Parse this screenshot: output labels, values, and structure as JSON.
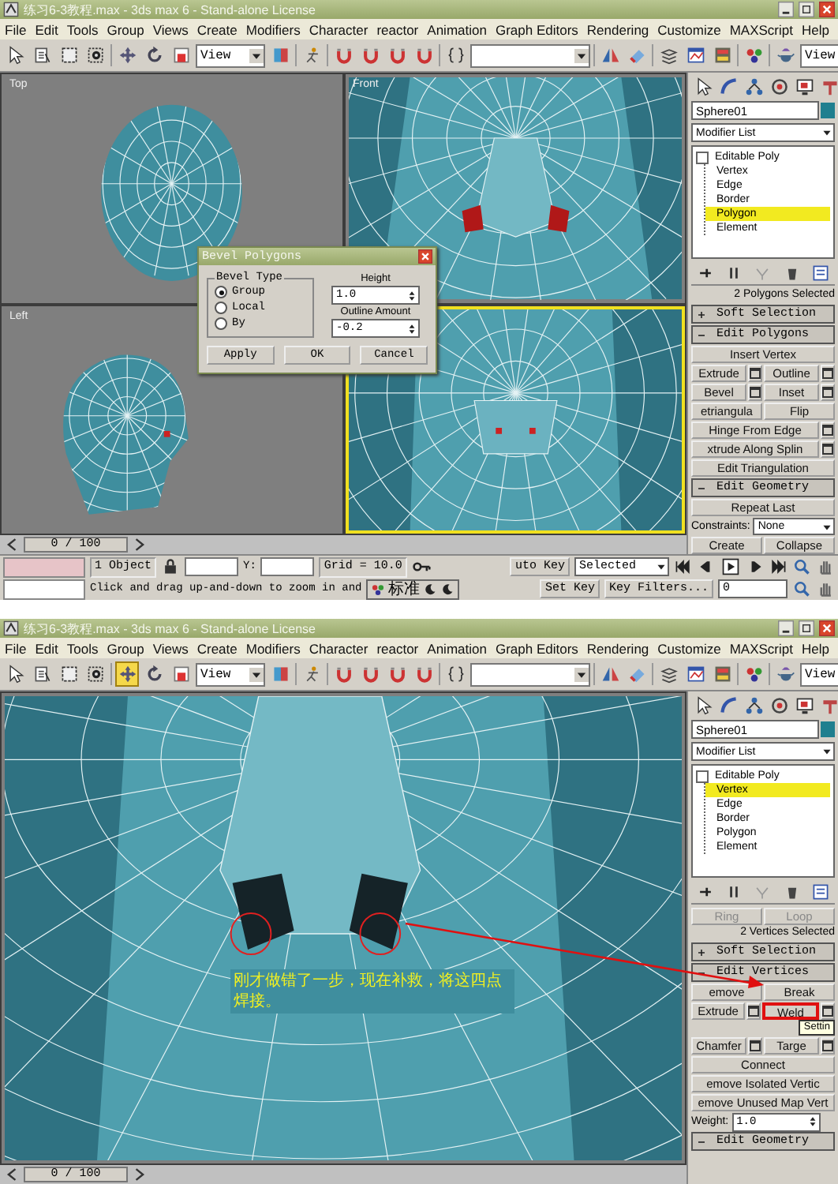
{
  "screens": [
    {
      "title": "练习6-3教程.max - 3ds max 6 - Stand-alone License",
      "menu": [
        "File",
        "Edit",
        "Tools",
        "Group",
        "Views",
        "Create",
        "Modifiers",
        "Character",
        "reactor",
        "Animation",
        "Graph Editors",
        "Rendering",
        "Customize",
        "MAXScript",
        "Help"
      ],
      "toolbar": {
        "tools": [
          {
            "selected": false
          },
          {
            "selected": false
          },
          {
            "selected": false
          },
          {
            "selected": false
          },
          {
            "selected": false
          },
          {
            "selected": false
          },
          {
            "selected": false
          },
          {
            "selected": false
          },
          {
            "selected": false
          },
          {
            "selected": false
          },
          {
            "selected": false
          },
          {
            "selected": false
          },
          {
            "selected": false
          },
          {
            "selected": false
          },
          {
            "selected": false
          },
          {
            "selected": false
          },
          {
            "selected": false
          },
          {
            "selected": false
          },
          {
            "selected": false
          },
          {
            "selected": false
          },
          {
            "selected": false
          }
        ],
        "dropdowns": [
          "View",
          "View"
        ]
      },
      "view": {
        "kind": "quad",
        "viewports": [
          {
            "label": "Top",
            "kind": "head-top",
            "active": false
          },
          {
            "label": "Front",
            "kind": "face-front",
            "active": false
          },
          {
            "label": "Left",
            "kind": "head-side",
            "active": false
          },
          {
            "kind": "face-persp",
            "active": true
          }
        ],
        "dialog": {
          "title": "Bevel Polygons",
          "group": "Bevel Type",
          "options": [
            {
              "label": "Group",
              "selected": true
            },
            {
              "label": "Local",
              "selected": false
            },
            {
              "label": "By",
              "selected": false
            }
          ],
          "fields": [
            {
              "label": "Height",
              "value": "1.0"
            },
            {
              "label": "Outline Amount",
              "value": "-0.2"
            }
          ],
          "buttons": [
            "Apply",
            "OK",
            "Cancel"
          ]
        }
      },
      "panel": {
        "object_name": "Sphere01",
        "modifier_list": "Modifier List",
        "stack": [
          {
            "label": "Editable Poly",
            "selected": false,
            "children": [
              {
                "label": "Vertex",
                "selected": false
              },
              {
                "label": "Edge",
                "selected": false
              },
              {
                "label": "Border",
                "selected": false
              },
              {
                "label": "Polygon",
                "selected": true
              },
              {
                "label": "Element",
                "selected": false
              }
            ]
          }
        ],
        "rollouts": [
          {
            "kind": "info",
            "text": "2 Polygons Selected"
          },
          {
            "kind": "rollout",
            "label": "Soft Selection",
            "expanded": false
          },
          {
            "kind": "rollout",
            "label": "Edit Polygons",
            "expanded": true
          },
          {
            "kind": "buttons",
            "buttons": [
              {
                "label": "Insert Vertex"
              }
            ]
          },
          {
            "kind": "buttons",
            "buttons": [
              {
                "label": "Extrude",
                "settings": true
              },
              {
                "label": "Outline",
                "settings": true
              }
            ]
          },
          {
            "kind": "buttons",
            "buttons": [
              {
                "label": "Bevel",
                "settings": true
              },
              {
                "label": "Inset",
                "settings": true
              }
            ]
          },
          {
            "kind": "buttons",
            "buttons": [
              {
                "label": "etriangula"
              },
              {
                "label": "Flip"
              }
            ]
          },
          {
            "kind": "buttons",
            "buttons": [
              {
                "label": "Hinge From Edge",
                "settings": true
              }
            ]
          },
          {
            "kind": "buttons",
            "buttons": [
              {
                "label": "xtrude Along Splin",
                "settings": true
              }
            ]
          },
          {
            "kind": "buttons",
            "buttons": [
              {
                "label": "Edit Triangulation"
              }
            ]
          },
          {
            "kind": "rollout",
            "label": "Edit Geometry",
            "expanded": true
          },
          {
            "kind": "buttons",
            "buttons": [
              {
                "label": "Repeat Last"
              }
            ]
          },
          {
            "kind": "dropdown",
            "label": "Constraints:",
            "value": "None"
          },
          {
            "kind": "buttons",
            "buttons": [
              {
                "label": "Create"
              },
              {
                "label": "Collapse"
              }
            ]
          }
        ]
      },
      "status": {
        "kind": "full",
        "frame": "0 / 100",
        "selection": "1 Object",
        "y_label": "Y:",
        "grid": "Grid = 10.0",
        "prompt": "Click and drag up-and-down to zoom in and",
        "ime": "标准",
        "auto_key": "uto Key",
        "key_mode": "Selected",
        "set_key": "Set Key",
        "key_filters": "Key Filters...",
        "frame_field": "0"
      }
    },
    {
      "title": "练习6-3教程.max - 3ds max 6 - Stand-alone License",
      "menu": [
        "File",
        "Edit",
        "Tools",
        "Group",
        "Views",
        "Create",
        "Modifiers",
        "Character",
        "reactor",
        "Animation",
        "Graph Editors",
        "Rendering",
        "Customize",
        "MAXScript",
        "Help"
      ],
      "toolbar": {
        "tools": [
          {
            "selected": false
          },
          {
            "selected": false
          },
          {
            "selected": false
          },
          {
            "selected": false
          },
          {
            "selected": true
          },
          {
            "selected": false
          },
          {
            "selected": false
          },
          {
            "selected": false
          },
          {
            "selected": false
          },
          {
            "selected": false
          },
          {
            "selected": false
          },
          {
            "selected": false
          },
          {
            "selected": false
          },
          {
            "selected": false
          },
          {
            "selected": false
          },
          {
            "selected": false
          },
          {
            "selected": false
          },
          {
            "selected": false
          },
          {
            "selected": false
          },
          {
            "selected": false
          },
          {
            "selected": false
          }
        ],
        "dropdowns": [
          "View",
          "View"
        ]
      },
      "view": {
        "kind": "single",
        "viewports": [
          {
            "kind": "face-closeup",
            "active": false
          }
        ],
        "annotation": "刚才做错了一步，现在补救，将这四点焊接。"
      },
      "panel": {
        "object_name": "Sphere01",
        "modifier_list": "Modifier List",
        "stack": [
          {
            "label": "Editable Poly",
            "selected": false,
            "children": [
              {
                "label": "Vertex",
                "selected": true
              },
              {
                "label": "Edge",
                "selected": false
              },
              {
                "label": "Border",
                "selected": false
              },
              {
                "label": "Polygon",
                "selected": false
              },
              {
                "label": "Element",
                "selected": false
              }
            ]
          }
        ],
        "rollouts": [
          {
            "kind": "buttons",
            "buttons": [
              {
                "label": "Ring",
                "disabled": true
              },
              {
                "label": "Loop",
                "disabled": true
              }
            ]
          },
          {
            "kind": "info",
            "text": "2 Vertices Selected"
          },
          {
            "kind": "rollout",
            "label": "Soft Selection",
            "expanded": false
          },
          {
            "kind": "rollout",
            "label": "Edit Vertices",
            "expanded": true
          },
          {
            "kind": "buttons",
            "buttons": [
              {
                "label": "emove"
              },
              {
                "label": "Break"
              }
            ]
          },
          {
            "kind": "buttons",
            "tooltip": "Settin",
            "buttons": [
              {
                "label": "Extrude",
                "settings": true
              },
              {
                "label": "Weld",
                "settings": true,
                "highlighted": true
              }
            ]
          },
          {
            "kind": "buttons",
            "buttons": [
              {
                "label": "Chamfer",
                "settings": true
              },
              {
                "label": "Targe",
                "settings": true
              }
            ]
          },
          {
            "kind": "buttons",
            "buttons": [
              {
                "label": "Connect"
              }
            ]
          },
          {
            "kind": "buttons",
            "buttons": [
              {
                "label": "emove Isolated Vertic"
              }
            ]
          },
          {
            "kind": "buttons",
            "buttons": [
              {
                "label": "emove Unused Map Vert"
              }
            ]
          },
          {
            "kind": "spinner",
            "label": "Weight:",
            "value": "1.0"
          },
          {
            "kind": "rollout",
            "label": "Edit Geometry",
            "expanded": true
          }
        ]
      },
      "status": {
        "kind": "slider",
        "frame": "0 / 100"
      }
    }
  ]
}
